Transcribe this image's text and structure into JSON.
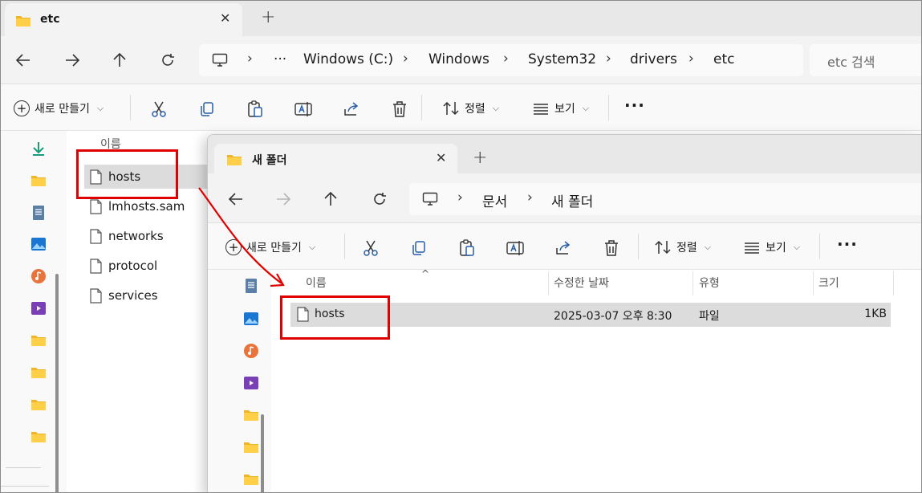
{
  "back_window": {
    "tab_title": "etc",
    "breadcrumb": [
      "Windows (C:)",
      "Windows",
      "System32",
      "drivers",
      "etc"
    ],
    "search_placeholder": "etc 검색",
    "toolbar": {
      "new_label": "새로 만들기",
      "sort_label": "정렬",
      "view_label": "보기"
    },
    "column_name": "이름",
    "files": [
      "hosts",
      "lmhosts.sam",
      "networks",
      "protocol",
      "services"
    ]
  },
  "front_window": {
    "tab_title": "새 폴더",
    "breadcrumb": [
      "문서",
      "새 폴더"
    ],
    "toolbar": {
      "new_label": "새로 만들기",
      "sort_label": "정렬",
      "view_label": "보기"
    },
    "columns": {
      "name": "이름",
      "modified": "수정한 날짜",
      "type": "유형",
      "size": "크기"
    },
    "rows": [
      {
        "name": "hosts",
        "modified": "2025-03-07 오후 8:30",
        "type": "파일",
        "size": "1KB"
      }
    ]
  },
  "colors": {
    "highlight": "#e10000",
    "folder": "#f0b429",
    "selection": "#dcdcdc"
  },
  "icons": {
    "nav": [
      "back-arrow-icon",
      "forward-arrow-icon",
      "up-arrow-icon",
      "refresh-icon",
      "this-pc-icon"
    ],
    "toolbar": [
      "cut-icon",
      "copy-icon",
      "paste-icon",
      "rename-icon",
      "share-icon",
      "delete-icon",
      "sort-icon",
      "view-icon",
      "more-icon"
    ]
  }
}
